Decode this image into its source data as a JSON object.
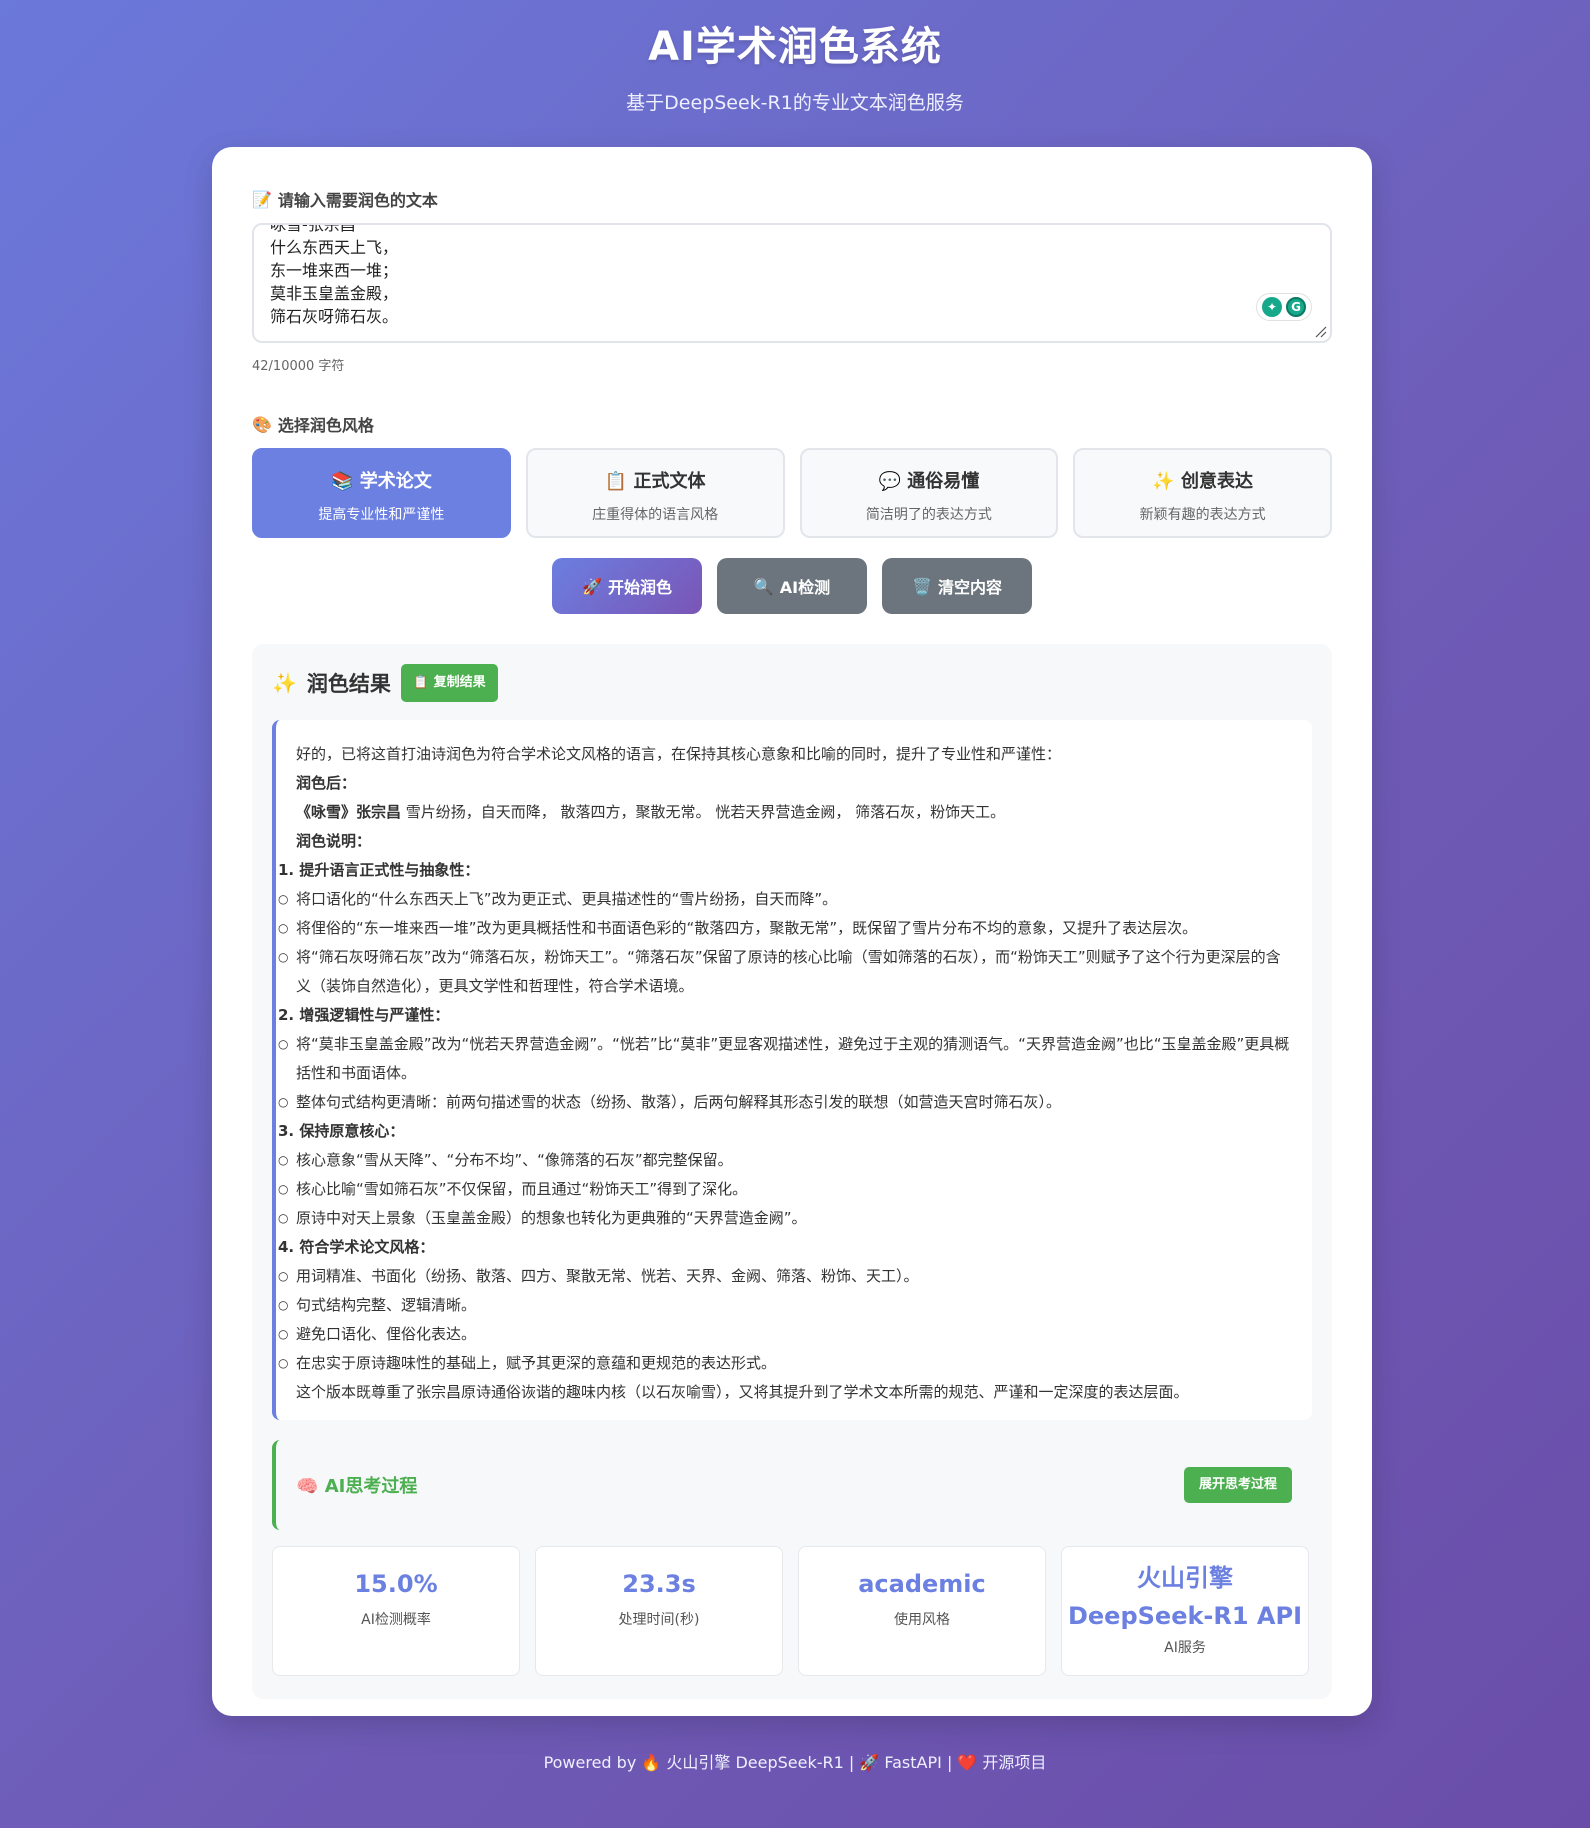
{
  "header": {
    "title": "AI学术润色系统",
    "subtitle": "基于DeepSeek-R1的专业文本润色服务"
  },
  "input": {
    "label_icon": "📝",
    "label": "请输入需要润色的文本",
    "lines": [
      "咏雪-张宗昌",
      "什么东西天上飞，",
      "东一堆来西一堆；",
      "莫非玉皇盖金殿，",
      "筛石灰呀筛石灰。"
    ],
    "char_count": "42/10000 字符"
  },
  "style_section": {
    "label_icon": "🎨",
    "label": "选择润色风格",
    "options": [
      {
        "icon": "📚",
        "title": "学术论文",
        "desc": "提高专业性和严谨性",
        "active": true
      },
      {
        "icon": "📋",
        "title": "正式文体",
        "desc": "庄重得体的语言风格",
        "active": false
      },
      {
        "icon": "💬",
        "title": "通俗易懂",
        "desc": "简洁明了的表达方式",
        "active": false
      },
      {
        "icon": "✨",
        "title": "创意表达",
        "desc": "新颖有趣的表达方式",
        "active": false
      }
    ]
  },
  "actions": {
    "start_icon": "🚀",
    "start": "开始润色",
    "detect_icon": "🔍",
    "detect": "AI检测",
    "clear_icon": "🗑️",
    "clear": "清空内容"
  },
  "result": {
    "title_icon": "✨",
    "title": "润色结果",
    "copy_icon": "📋",
    "copy": "复制结果",
    "intro": "好的，已将这首打油诗润色为符合学术论文风格的语言，在保持其核心意象和比喻的同时，提升了专业性和严谨性：",
    "after_label": "润色后：",
    "poem_title": "《咏雪》张宗昌",
    "poem_body": " 雪片纷扬，自天而降， 散落四方，聚散无常。 恍若天界营造金阙， 筛落石灰，粉饰天工。",
    "notes_label": "润色说明：",
    "sections": [
      {
        "num": "1.",
        "title": "提升语言正式性与抽象性：",
        "items": [
          "将口语化的“什么东西天上飞”改为更正式、更具描述性的“雪片纷扬，自天而降”。",
          "将俚俗的“东一堆来西一堆”改为更具概括性和书面语色彩的“散落四方，聚散无常”，既保留了雪片分布不均的意象，又提升了表达层次。",
          "将“筛石灰呀筛石灰”改为“筛落石灰，粉饰天工”。“筛落石灰”保留了原诗的核心比喻（雪如筛落的石灰），而“粉饰天工”则赋予了这个行为更深层的含义（装饰自然造化），更具文学性和哲理性，符合学术语境。"
        ]
      },
      {
        "num": "2.",
        "title": "增强逻辑性与严谨性：",
        "items": [
          "将“莫非玉皇盖金殿”改为“恍若天界营造金阙”。“恍若”比“莫非”更显客观描述性，避免过于主观的猜测语气。“天界营造金阙”也比“玉皇盖金殿”更具概括性和书面语体。",
          "整体句式结构更清晰：前两句描述雪的状态（纷扬、散落），后两句解释其形态引发的联想（如营造天宫时筛石灰）。"
        ]
      },
      {
        "num": "3.",
        "title": "保持原意核心：",
        "items": [
          "核心意象“雪从天降”、“分布不均”、“像筛落的石灰”都完整保留。",
          "核心比喻“雪如筛石灰”不仅保留，而且通过“粉饰天工”得到了深化。",
          "原诗中对天上景象（玉皇盖金殿）的想象也转化为更典雅的“天界营造金阙”。"
        ]
      },
      {
        "num": "4.",
        "title": "符合学术论文风格：",
        "items": [
          "用词精准、书面化（纷扬、散落、四方、聚散无常、恍若、天界、金阙、筛落、粉饰、天工）。",
          "句式结构完整、逻辑清晰。",
          "避免口语化、俚俗化表达。",
          "在忠实于原诗趣味性的基础上，赋予其更深的意蕴和更规范的表达形式。"
        ]
      }
    ],
    "conclusion": "这个版本既尊重了张宗昌原诗通俗诙谐的趣味内核（以石灰喻雪），又将其提升到了学术文本所需的规范、严谨和一定深度的表达层面。"
  },
  "thinking": {
    "icon": "🧠",
    "title": "AI思考过程",
    "expand": "展开思考过程"
  },
  "stats": [
    {
      "value": "15.0%",
      "label": "AI检测概率"
    },
    {
      "value": "23.3s",
      "label": "处理时间(秒)"
    },
    {
      "value": "academic",
      "label": "使用风格"
    },
    {
      "value": "火山引擎",
      "value2": "DeepSeek-R1 API",
      "label": "AI服务"
    }
  ],
  "footer": "Powered by 🔥 火山引擎 DeepSeek-R1 | 🚀 FastAPI | ❤️ 开源项目",
  "colors": {
    "accent": "#6b80e0",
    "success": "#4caf50",
    "secondary": "#6c757d"
  }
}
